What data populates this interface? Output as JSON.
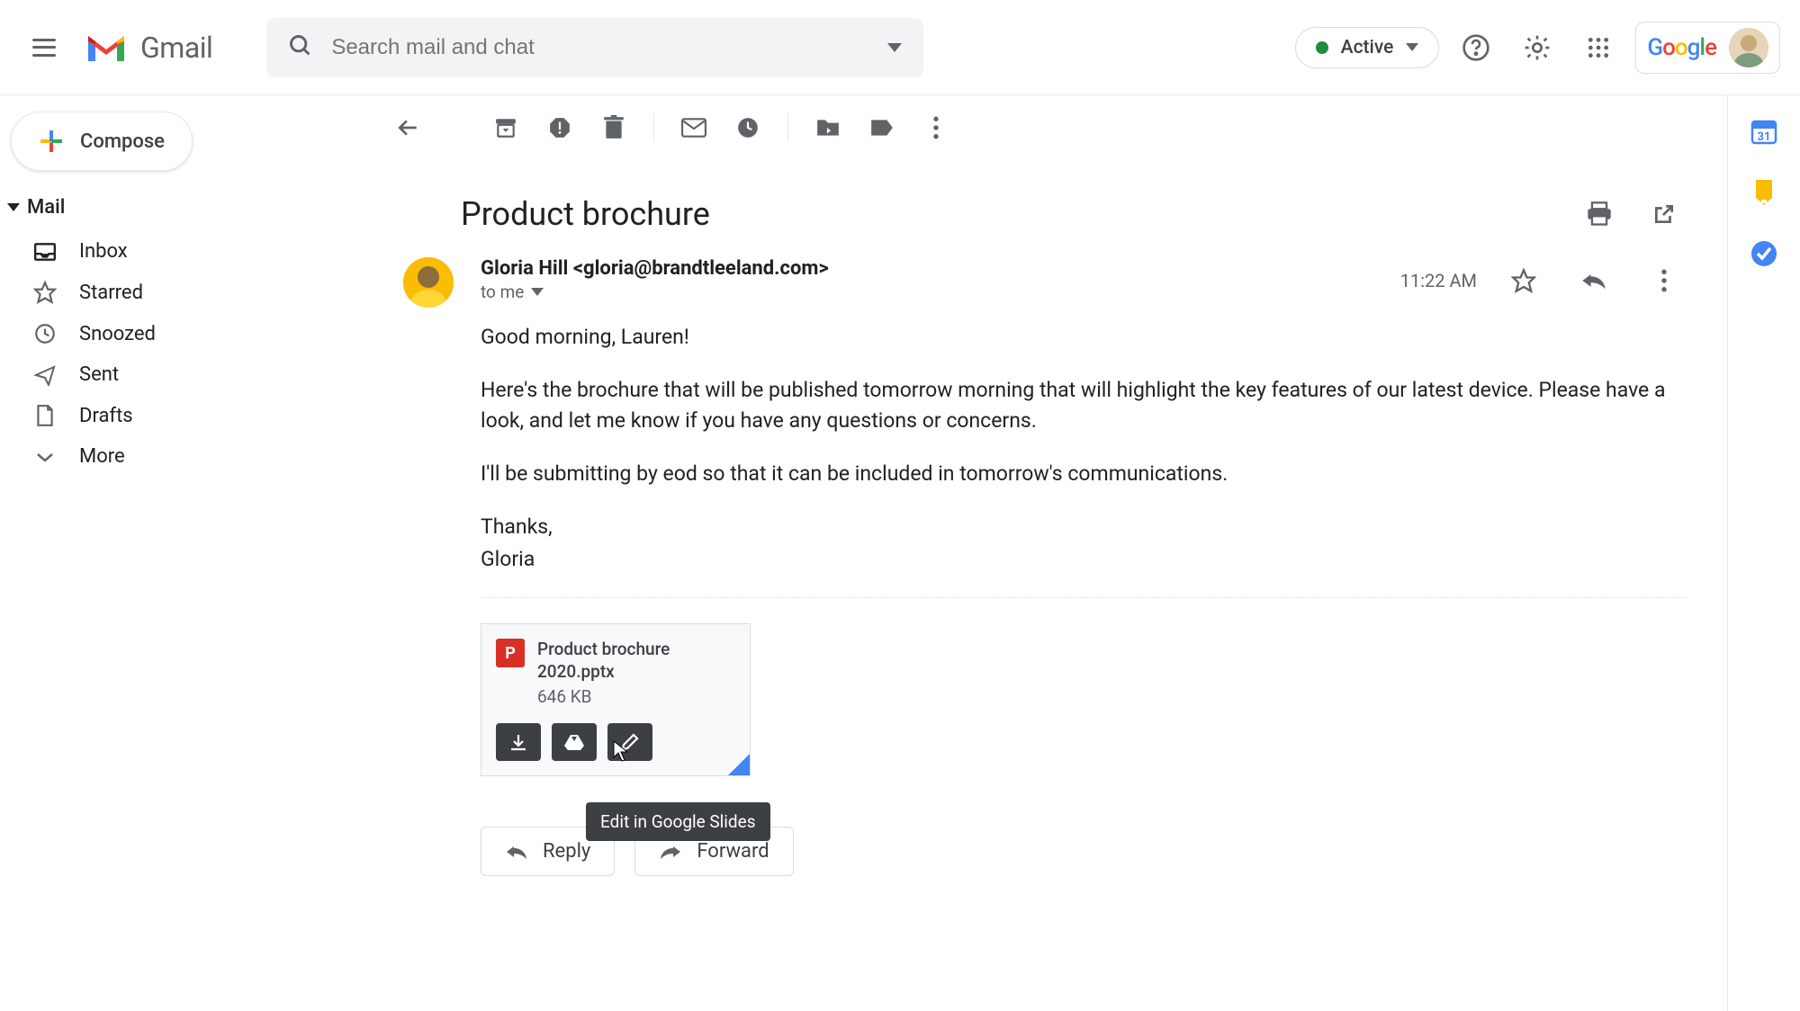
{
  "header": {
    "app_name": "Gmail",
    "search_placeholder": "Search mail and chat",
    "status_label": "Active",
    "google_word": "Google"
  },
  "sidebar": {
    "compose_label": "Compose",
    "mail_label": "Mail",
    "folders": [
      {
        "label": "Inbox",
        "icon": "inbox"
      },
      {
        "label": "Starred",
        "icon": "star"
      },
      {
        "label": "Snoozed",
        "icon": "clock"
      },
      {
        "label": "Sent",
        "icon": "send"
      },
      {
        "label": "Drafts",
        "icon": "file"
      },
      {
        "label": "More",
        "icon": "chevron-down"
      }
    ]
  },
  "message": {
    "subject": "Product brochure",
    "sender": "Gloria Hill <gloria@brandtleeland.com>",
    "recipient_line": "to me",
    "time": "11:22 AM",
    "body_lines": [
      "Good morning, Lauren!",
      "Here's the brochure that will be published tomorrow morning that will highlight the key features of our latest device. Please have a look, and let me know if you have any questions or concerns.",
      "I'll be submitting by eod so that it can be included in tomorrow's communications.",
      "Thanks,",
      "Gloria"
    ],
    "attachment": {
      "name": "Product brochure 2020.pptx",
      "size": "646 KB",
      "tooltip": "Edit in Google Slides"
    },
    "reply_label": "Reply",
    "forward_label": "Forward"
  }
}
